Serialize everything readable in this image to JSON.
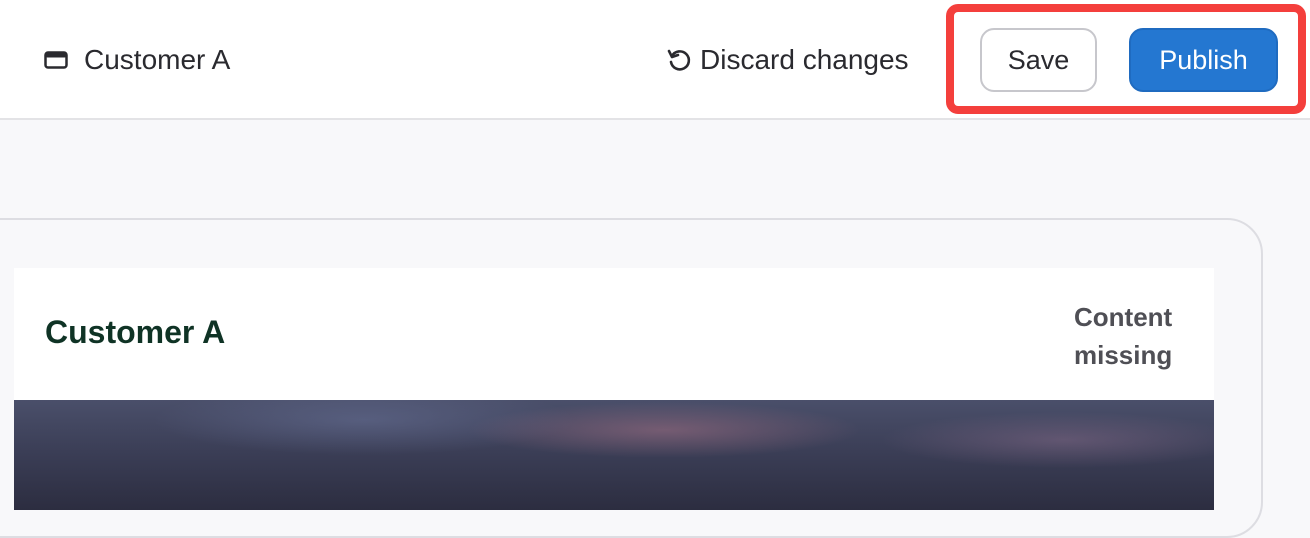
{
  "topbar": {
    "window_title": "Customer A",
    "discard_label": "Discard changes",
    "save_label": "Save",
    "publish_label": "Publish"
  },
  "card": {
    "title": "Customer A",
    "status": "Content missing"
  },
  "colors": {
    "publish_bg": "#2477d1",
    "highlight": "#f43f3c",
    "card_title": "#0f3325"
  },
  "icons": {
    "window": "browser-window-icon",
    "discard": "undo-icon"
  }
}
